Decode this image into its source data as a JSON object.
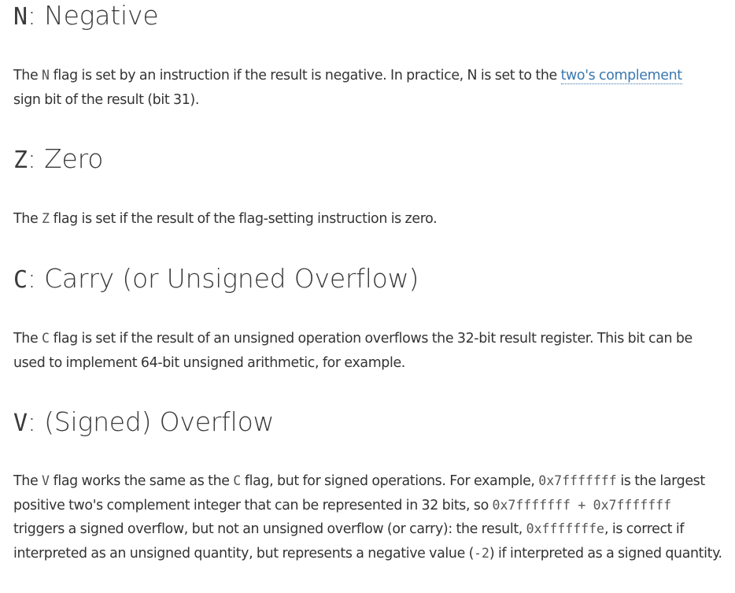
{
  "sections": {
    "n": {
      "heading_code": "N",
      "heading_text": ": Negative",
      "p_prefix": "The ",
      "p_code": "N",
      "p_text1": " flag is set by an instruction if the result is negative. In practice, N is set to the ",
      "p_link": "two's complement",
      "p_text2": " sign bit of the result (bit 31)."
    },
    "z": {
      "heading_code": "Z",
      "heading_text": ": Zero",
      "p_prefix": "The ",
      "p_code": "Z",
      "p_text": " flag is set if the result of the flag-setting instruction is zero."
    },
    "c": {
      "heading_code": "C",
      "heading_text": ": Carry (or Unsigned Overflow)",
      "p_prefix": "The ",
      "p_code": "C",
      "p_text": " flag is set if the result of an unsigned operation overflows the 32-bit result register. This bit can be used to implement 64-bit unsigned arithmetic, for example."
    },
    "v": {
      "heading_code": "V",
      "heading_text": ": (Signed) Overflow",
      "p_prefix": "The ",
      "p_code1": "V",
      "p_text1": " flag works the same as the ",
      "p_code2": "C",
      "p_text2": " flag, but for signed operations. For example, ",
      "p_code3": "0x7fffffff",
      "p_text3": " is the largest positive two's complement integer that can be represented in 32 bits, so ",
      "p_code4": "0x7fffffff + 0x7fffffff",
      "p_text4": " triggers a signed overflow, but not an unsigned overflow (or carry): the result, ",
      "p_code5": "0xfffffffe",
      "p_text5": ", is correct if interpreted as an unsigned quantity, but represents a negative value (",
      "p_code6": "-2",
      "p_text6": ") if interpreted as a signed quantity."
    }
  }
}
